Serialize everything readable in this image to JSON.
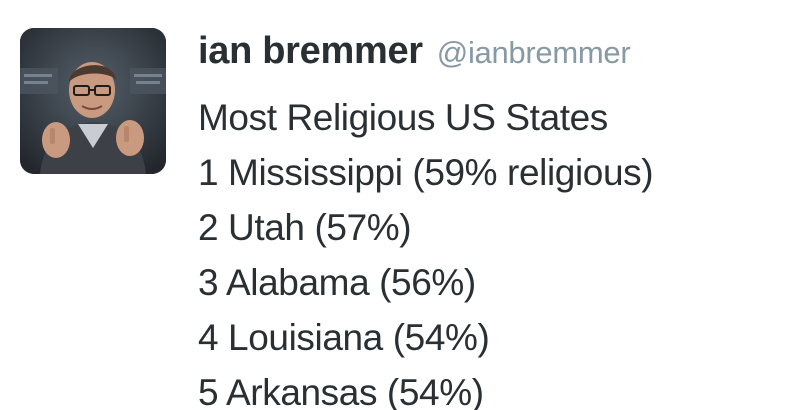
{
  "author": {
    "display_name": "ian bremmer",
    "handle": "@ianbremmer"
  },
  "tweet": {
    "lines": [
      "Most Religious US States",
      "1 Mississippi (59% religious)",
      "2 Utah (57%)",
      "3 Alabama (56%)",
      "4 Louisiana (54%)",
      "5 Arkansas (54%)"
    ]
  },
  "colors": {
    "name": "#292f33",
    "handle": "#8899a6",
    "text": "#292f33"
  }
}
